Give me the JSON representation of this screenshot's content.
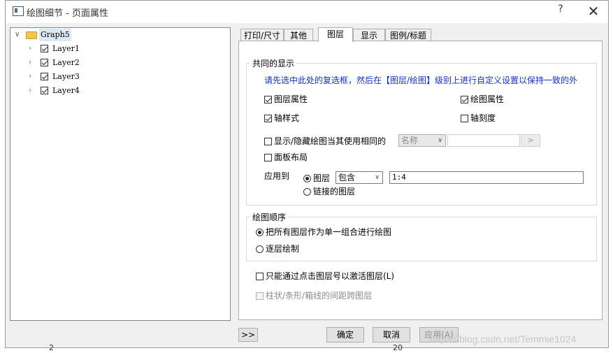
{
  "window": {
    "title": "绘图细节 - 页面属性",
    "help_glyph": "?",
    "close_glyph": "✕"
  },
  "tree": {
    "root": {
      "label": "Graph5",
      "expander": "∨"
    },
    "layers": [
      {
        "label": "Layer1",
        "checked": true,
        "expander": "›"
      },
      {
        "label": "Layer2",
        "checked": true,
        "expander": "›"
      },
      {
        "label": "Layer3",
        "checked": true,
        "expander": "›"
      },
      {
        "label": "Layer4",
        "checked": true,
        "expander": "›"
      }
    ]
  },
  "tabs": [
    {
      "label": "打印/尺寸",
      "active": false
    },
    {
      "label": "其他",
      "active": false
    },
    {
      "label": "图层",
      "active": true
    },
    {
      "label": "显示",
      "active": false
    },
    {
      "label": "图例/标题",
      "active": false
    }
  ],
  "common_display": {
    "legend": "共同的显示",
    "instruction": "请先选中此处的复选框，然后在【图层/绘图】级别上进行自定义设置以保持一致的外",
    "layer_props": {
      "label": "图层属性",
      "checked": true
    },
    "plot_props": {
      "label": "绘图属性",
      "checked": true
    },
    "axis_style": {
      "label": "轴样式",
      "checked": true
    },
    "axis_scale": {
      "label": "轴刻度",
      "checked": false
    },
    "show_hide": {
      "label": "显示/隐藏绘图当其使用相同的",
      "checked": false
    },
    "name_combo": {
      "value": "名称",
      "arrow": "∨"
    },
    "browse_button": {
      "label": ">"
    },
    "panel_layout": {
      "label": "面板布局",
      "checked": false
    },
    "apply_to": {
      "label": "应用到",
      "layers_option": {
        "label": "图层",
        "selected": true
      },
      "include_combo": {
        "value": "包含",
        "arrow": "∨"
      },
      "range_value": "1:4",
      "linked_option": {
        "label": "链接的图层",
        "selected": false
      }
    }
  },
  "plot_order": {
    "legend": "绘图顺序",
    "single_group": {
      "label": "把所有图层作为单一组合进行绘图",
      "selected": true
    },
    "layer_by_layer": {
      "label": "逐层绘制",
      "selected": false
    }
  },
  "activate_by_click": {
    "label": "只能通过点击图层号以激活图层(L)",
    "checked": false
  },
  "bar_spacing": {
    "label": "柱状/条形/箱线的间距跨图层",
    "checked": false,
    "disabled": true
  },
  "footer": {
    "expand_button": ">>",
    "ok_button": "确定",
    "cancel_button": "取消",
    "apply_button": "应用(A)"
  },
  "watermark": "https://blog.csdn.net/Temmie1024",
  "background_labels": {
    "left": "2",
    "right": "20"
  }
}
